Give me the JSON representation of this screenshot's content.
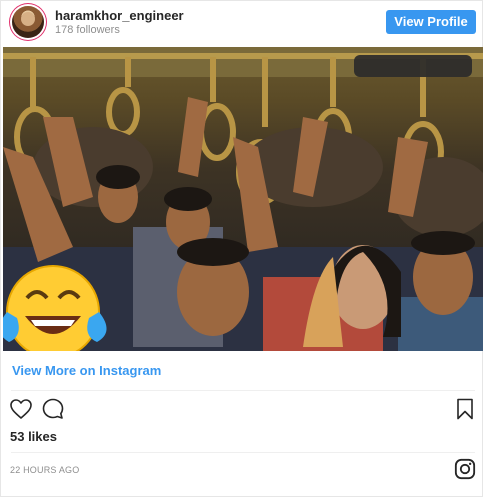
{
  "post": {
    "username": "haramkhor_engineer",
    "followers": "178 followers",
    "view_profile_label": "View Profile",
    "view_more_label": "View More on Instagram",
    "likes": "53 likes",
    "timestamp": "22 HOURS AGO"
  },
  "icons": {
    "like": "heart-icon",
    "comment": "comment-icon",
    "save": "bookmark-icon",
    "brand": "instagram-icon",
    "emoji": "laughing-tears-emoji"
  },
  "colors": {
    "accent": "#3897f0",
    "text": "#262626",
    "muted": "#8e8e8e"
  }
}
